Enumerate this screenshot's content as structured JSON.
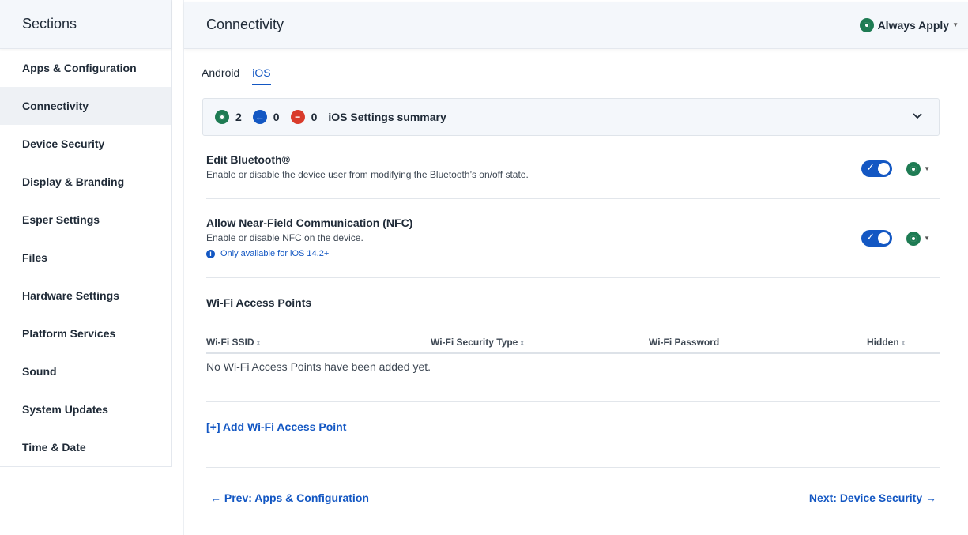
{
  "sidebar": {
    "title": "Sections",
    "items": [
      {
        "label": "Apps & Configuration"
      },
      {
        "label": "Connectivity"
      },
      {
        "label": "Device Security"
      },
      {
        "label": "Display & Branding"
      },
      {
        "label": "Esper Settings"
      },
      {
        "label": "Files"
      },
      {
        "label": "Hardware Settings"
      },
      {
        "label": "Platform Services"
      },
      {
        "label": "Sound"
      },
      {
        "label": "System Updates"
      },
      {
        "label": "Time & Date"
      }
    ],
    "active_index": 1
  },
  "header": {
    "title": "Connectivity",
    "apply_label": "Always Apply"
  },
  "tabs": [
    {
      "label": "Android"
    },
    {
      "label": "iOS"
    }
  ],
  "active_tab": "iOS",
  "summary": {
    "applied_count": "2",
    "inherited_count": "0",
    "blocked_count": "0",
    "title": "iOS Settings summary"
  },
  "settings": [
    {
      "title": "Edit Bluetooth®",
      "description": "Enable or disable the device user from modifying the Bluetooth’s on/off state.",
      "enabled": true
    },
    {
      "title": "Allow Near-Field Communication (NFC)",
      "description": "Enable or disable NFC on the device.",
      "note": "Only available for iOS 14.2+",
      "enabled": true
    }
  ],
  "wifi": {
    "title": "Wi-Fi Access Points",
    "columns": [
      "Wi-Fi SSID",
      "Wi-Fi Security Type",
      "Wi-Fi Password",
      "Hidden"
    ],
    "empty_text": "No Wi-Fi Access Points have been added yet.",
    "add_label": "[+] Add Wi-Fi Access Point"
  },
  "navigation": {
    "prev_label": "Prev: Apps & Configuration",
    "next_label": "Next: Device Security"
  },
  "colors": {
    "accent": "#1357c3",
    "applied": "#1e7b53",
    "blocked": "#d93b2b",
    "header_bg": "#f4f7fb"
  }
}
